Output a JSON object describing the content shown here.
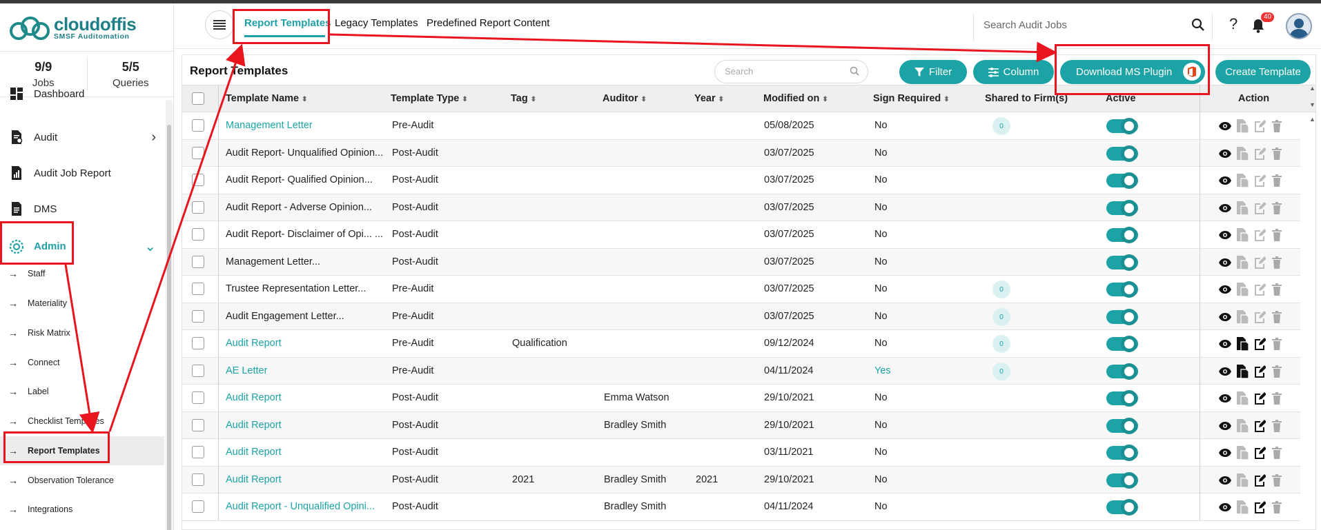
{
  "app": {
    "logo_name": "cloudoffis",
    "logo_tagline": "SMSF Auditomation"
  },
  "stats": [
    {
      "value": "9/9",
      "label": "Jobs"
    },
    {
      "value": "5/5",
      "label": "Queries"
    }
  ],
  "sidebar": {
    "items": [
      {
        "label": "Dashboard",
        "icon": "dashboard-icon"
      },
      {
        "label": "Audit",
        "icon": "audit-file-icon"
      },
      {
        "label": "Audit Job Report",
        "icon": "report-chart-icon"
      },
      {
        "label": "DMS",
        "icon": "document-icon"
      },
      {
        "label": "Admin",
        "icon": "admin-gear-icon"
      }
    ],
    "admin_subitems": [
      "Staff",
      "Materiality",
      "Risk Matrix",
      "Connect",
      "Label",
      "Checklist Templates",
      "Report Templates",
      "Observation Tolerance",
      "Integrations"
    ]
  },
  "header": {
    "tabs": [
      "Report Templates",
      "Legacy Templates",
      "Predefined Report Content"
    ],
    "search_placeholder": "Search Audit Jobs",
    "notification_count": "40"
  },
  "panel": {
    "title": "Report Templates",
    "search_placeholder": "Search",
    "filter_label": "Filter",
    "column_label": "Column",
    "download_label": "Download MS Plugin",
    "create_label": "Create Template"
  },
  "table": {
    "columns": [
      "Template Name",
      "Template Type",
      "Tag",
      "Auditor",
      "Year",
      "Modified on",
      "Sign Required",
      "Shared to Firm(s)",
      "Active",
      "Action"
    ],
    "rows": [
      {
        "name": "Management Letter",
        "type": "Pre-Audit",
        "tag": "",
        "auditor": "",
        "year": "",
        "modified": "05/08/2025",
        "sign": "No",
        "shared": "0",
        "link": true
      },
      {
        "name": "Audit Report- Unqualified Opinion...",
        "type": "Post-Audit",
        "tag": "",
        "auditor": "",
        "year": "",
        "modified": "03/07/2025",
        "sign": "No",
        "shared": "",
        "link": false
      },
      {
        "name": "Audit Report- Qualified Opinion...",
        "type": "Post-Audit",
        "tag": "",
        "auditor": "",
        "year": "",
        "modified": "03/07/2025",
        "sign": "No",
        "shared": "",
        "link": false
      },
      {
        "name": "Audit Report - Adverse Opinion...",
        "type": "Post-Audit",
        "tag": "",
        "auditor": "",
        "year": "",
        "modified": "03/07/2025",
        "sign": "No",
        "shared": "",
        "link": false
      },
      {
        "name": "Audit Report- Disclaimer of Opi... ...",
        "type": "Post-Audit",
        "tag": "",
        "auditor": "",
        "year": "",
        "modified": "03/07/2025",
        "sign": "No",
        "shared": "",
        "link": false
      },
      {
        "name": "Management Letter...",
        "type": "Post-Audit",
        "tag": "",
        "auditor": "",
        "year": "",
        "modified": "03/07/2025",
        "sign": "No",
        "shared": "",
        "link": false
      },
      {
        "name": "Trustee Representation Letter...",
        "type": "Pre-Audit",
        "tag": "",
        "auditor": "",
        "year": "",
        "modified": "03/07/2025",
        "sign": "No",
        "shared": "0",
        "link": false
      },
      {
        "name": "Audit Engagement Letter...",
        "type": "Pre-Audit",
        "tag": "",
        "auditor": "",
        "year": "",
        "modified": "03/07/2025",
        "sign": "No",
        "shared": "0",
        "link": false
      },
      {
        "name": "Audit Report",
        "type": "Pre-Audit",
        "tag": "Qualification",
        "auditor": "",
        "year": "",
        "modified": "09/12/2024",
        "sign": "No",
        "shared": "0",
        "link": true
      },
      {
        "name": "AE Letter",
        "type": "Pre-Audit",
        "tag": "",
        "auditor": "",
        "year": "",
        "modified": "04/11/2024",
        "sign": "Yes",
        "shared": "0",
        "link": true
      },
      {
        "name": "Audit Report",
        "type": "Post-Audit",
        "tag": "",
        "auditor": "Emma Watson",
        "year": "",
        "modified": "29/10/2021",
        "sign": "No",
        "shared": "",
        "link": true
      },
      {
        "name": "Audit Report",
        "type": "Post-Audit",
        "tag": "",
        "auditor": "Bradley Smith",
        "year": "",
        "modified": "29/10/2021",
        "sign": "No",
        "shared": "",
        "link": true
      },
      {
        "name": "Audit Report",
        "type": "Post-Audit",
        "tag": "",
        "auditor": "",
        "year": "",
        "modified": "03/11/2021",
        "sign": "No",
        "shared": "",
        "link": true
      },
      {
        "name": "Audit Report",
        "type": "Post-Audit",
        "tag": "2021",
        "auditor": "Bradley Smith",
        "year": "2021",
        "modified": "29/10/2021",
        "sign": "No",
        "shared": "",
        "link": true
      },
      {
        "name": "Audit Report - Unqualified Opini...",
        "type": "Post-Audit",
        "tag": "",
        "auditor": "Bradley Smith",
        "year": "",
        "modified": "04/11/2024",
        "sign": "No",
        "shared": "",
        "link": true
      }
    ]
  },
  "colors": {
    "accent": "#1ba3a6",
    "annotation": "#e8151f",
    "brand": "#1f7f86"
  }
}
